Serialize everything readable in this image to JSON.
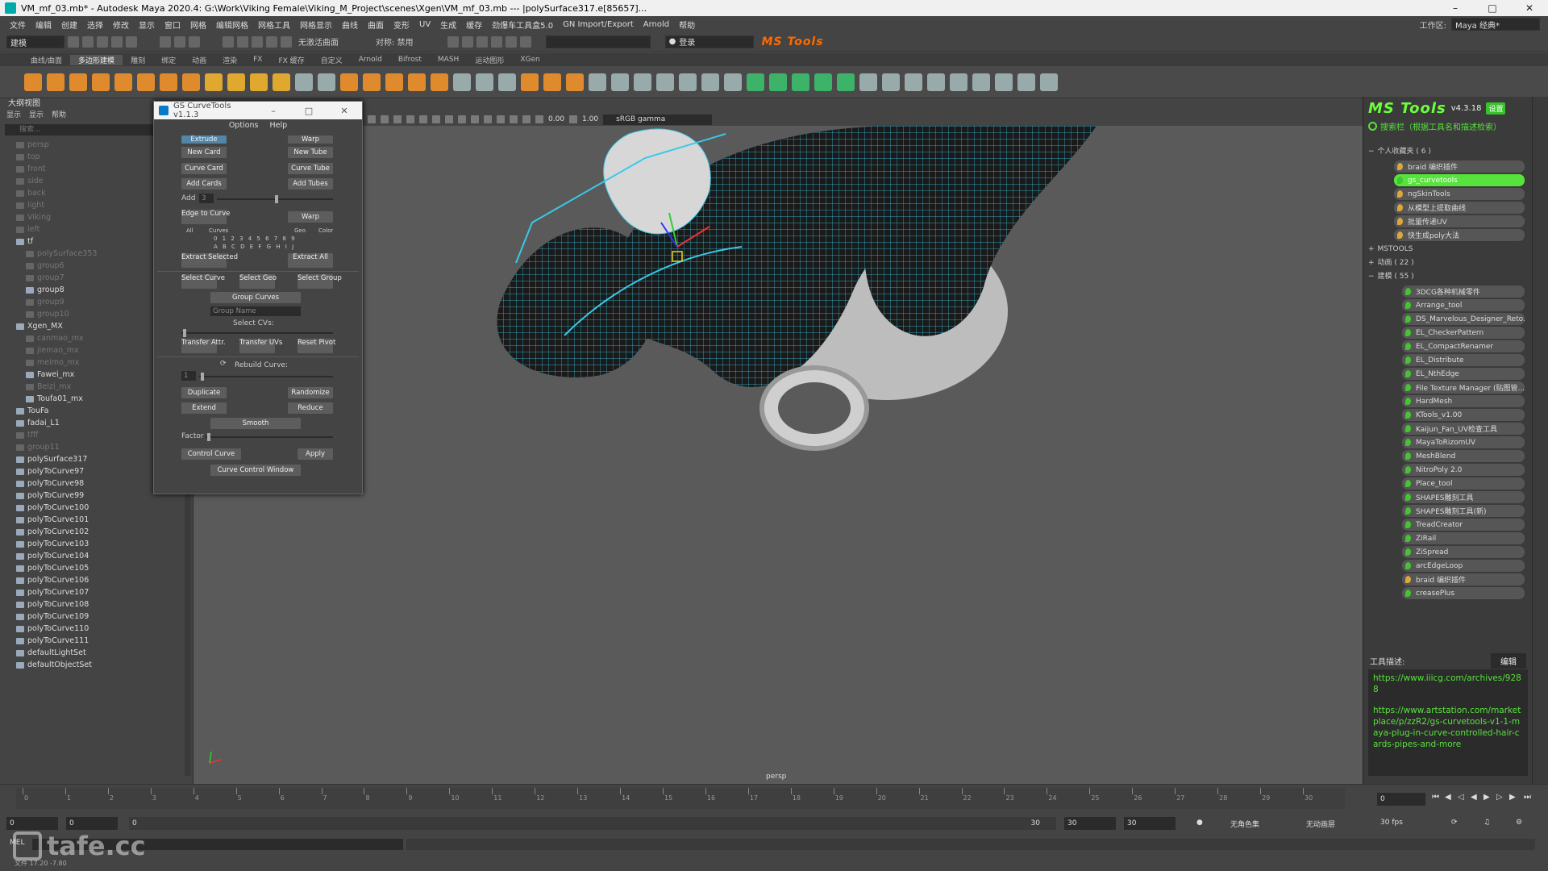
{
  "window": {
    "title": "VM_mf_03.mb* - Autodesk Maya 2020.4: G:\\Work\\Viking Female\\Viking_M_Project\\scenes\\Xgen\\VM_mf_03.mb   ---   |polySurface317.e[85657]..."
  },
  "menubar": {
    "items": [
      "文件",
      "编辑",
      "创建",
      "选择",
      "修改",
      "显示",
      "窗口",
      "网格",
      "编辑网格",
      "网格工具",
      "网格显示",
      "曲线",
      "曲面",
      "变形",
      "UV",
      "生成",
      "缓存",
      "劲爆车工具盒5.0",
      "GN Import/Export",
      "Arnold",
      "帮助"
    ],
    "workspace_label": "工作区:",
    "workspace_value": "Maya 经典*"
  },
  "statusline": {
    "mode": "建模",
    "symmetry": "无激活曲面",
    "symmetry2": "对称: 禁用",
    "login": "登录",
    "logo": "MS Tools"
  },
  "shelf": {
    "tabs": [
      "曲线/曲面",
      "多边形建模",
      "雕刻",
      "绑定",
      "动画",
      "渲染",
      "FX",
      "FX 缓存",
      "自定义",
      "Arnold",
      "Bifrost",
      "MASH",
      "运动图形",
      "XGen"
    ],
    "active_tab": 1
  },
  "outliner": {
    "title": "大纲视图",
    "menu": [
      "显示",
      "显示",
      "帮助"
    ],
    "search_placeholder": "搜索...",
    "rows": [
      {
        "label": "persp",
        "dim": true,
        "indent": 1
      },
      {
        "label": "top",
        "dim": true,
        "indent": 1
      },
      {
        "label": "front",
        "dim": true,
        "indent": 1
      },
      {
        "label": "side",
        "dim": true,
        "indent": 1
      },
      {
        "label": "back",
        "dim": true,
        "indent": 1
      },
      {
        "label": "light",
        "dim": true,
        "indent": 1
      },
      {
        "label": "Viking",
        "dim": true,
        "indent": 1
      },
      {
        "label": "left",
        "dim": true,
        "indent": 1
      },
      {
        "label": "tf",
        "dim": false,
        "indent": 1
      },
      {
        "label": "polySurface353",
        "dim": true,
        "indent": 2
      },
      {
        "label": "group6",
        "dim": true,
        "indent": 2
      },
      {
        "label": "group7",
        "dim": true,
        "indent": 2
      },
      {
        "label": "group8",
        "dim": false,
        "indent": 2
      },
      {
        "label": "group9",
        "dim": true,
        "indent": 2
      },
      {
        "label": "group10",
        "dim": true,
        "indent": 2
      },
      {
        "label": "Xgen_MX",
        "dim": false,
        "indent": 1
      },
      {
        "label": "canmao_mx",
        "dim": true,
        "indent": 2
      },
      {
        "label": "jiemao_mx",
        "dim": true,
        "indent": 2
      },
      {
        "label": "meimo_mx",
        "dim": true,
        "indent": 2
      },
      {
        "label": "Fawei_mx",
        "dim": false,
        "indent": 2
      },
      {
        "label": "Beizi_mx",
        "dim": true,
        "indent": 2
      },
      {
        "label": "Toufa01_mx",
        "dim": false,
        "indent": 2
      },
      {
        "label": "TouFa",
        "dim": false,
        "indent": 1
      },
      {
        "label": "fadai_L1",
        "dim": false,
        "indent": 1
      },
      {
        "label": "tfff",
        "dim": true,
        "indent": 1
      },
      {
        "label": "group11",
        "dim": true,
        "indent": 1
      },
      {
        "label": "polySurface317",
        "dim": false,
        "indent": 1
      },
      {
        "label": "polyToCurve97",
        "dim": false,
        "indent": 1
      },
      {
        "label": "polyToCurve98",
        "dim": false,
        "indent": 1
      },
      {
        "label": "polyToCurve99",
        "dim": false,
        "indent": 1
      },
      {
        "label": "polyToCurve100",
        "dim": false,
        "indent": 1
      },
      {
        "label": "polyToCurve101",
        "dim": false,
        "indent": 1
      },
      {
        "label": "polyToCurve102",
        "dim": false,
        "indent": 1
      },
      {
        "label": "polyToCurve103",
        "dim": false,
        "indent": 1
      },
      {
        "label": "polyToCurve104",
        "dim": false,
        "indent": 1
      },
      {
        "label": "polyToCurve105",
        "dim": false,
        "indent": 1
      },
      {
        "label": "polyToCurve106",
        "dim": false,
        "indent": 1
      },
      {
        "label": "polyToCurve107",
        "dim": false,
        "indent": 1
      },
      {
        "label": "polyToCurve108",
        "dim": false,
        "indent": 1
      },
      {
        "label": "polyToCurve109",
        "dim": false,
        "indent": 1
      },
      {
        "label": "polyToCurve110",
        "dim": false,
        "indent": 1
      },
      {
        "label": "polyToCurve111",
        "dim": false,
        "indent": 1
      },
      {
        "label": "defaultLightSet",
        "dim": false,
        "indent": 1
      },
      {
        "label": "defaultObjectSet",
        "dim": false,
        "indent": 1
      }
    ]
  },
  "gs": {
    "title": "GS CurveTools v1.1.3",
    "menu": [
      "Options",
      "Help"
    ],
    "extrude": "Extrude",
    "warp_toggle": "Warp",
    "new_card": "New Card",
    "new_tube": "New Tube",
    "curve_card": "Curve Card",
    "curve_tube": "Curve Tube",
    "add_cards": "Add Cards",
    "add_tubes": "Add Tubes",
    "add_label": "Add",
    "add_value": "3",
    "edge_to_curve": "Edge to Curve",
    "warp": "Warp",
    "all": "All",
    "curves": "Curves",
    "geo": "Geo",
    "color": "Color",
    "layers_top": "0 1 2 3 4 5 6 7 8 9",
    "layers_bottom": "A B C D E F G H I J",
    "extract_selected": "Extract Selected",
    "extract_all": "Extract All",
    "select_curve": "Select Curve",
    "select_geo": "Select Geo",
    "select_group": "Select Group",
    "group_curves": "Group Curves",
    "group_name": "Group Name",
    "select_cvs": "Select CVs:",
    "transfer_attr": "Transfer Attr.",
    "transfer_uvs": "Transfer UVs",
    "reset_pivot": "Reset Pivot",
    "rebuild_curve": "Rebuild Curve:",
    "rebuild_value": "1",
    "duplicate": "Duplicate",
    "randomize": "Randomize",
    "extend": "Extend",
    "reduce": "Reduce",
    "smooth": "Smooth",
    "factor": "Factor",
    "control_curve": "Control Curve",
    "apply": "Apply",
    "curve_control_window": "Curve Control Window"
  },
  "viewport": {
    "value1": "0.00",
    "value2": "1.00",
    "color_space": "sRGB gamma",
    "camera": "persp"
  },
  "mstools": {
    "logo": "MS Tools",
    "version": "v4.3.18",
    "settings": "设置",
    "search": "搜索栏（根据工具名和描述检索）",
    "sections": [
      {
        "label": "个人收藏夹 ( 6 )",
        "items": [
          {
            "label": "braid 编织插件",
            "sel": false,
            "gold": true
          },
          {
            "label": "gs_curvetools",
            "sel": true,
            "gold": false
          },
          {
            "label": "ngSkinTools",
            "sel": false,
            "gold": true
          },
          {
            "label": "从模型上提取曲线",
            "sel": false,
            "gold": true
          },
          {
            "label": "批量传递UV",
            "sel": false,
            "gold": true
          },
          {
            "label": "快生成poly大法",
            "sel": false,
            "gold": true
          }
        ]
      },
      {
        "label": "MSTOOLS",
        "items": []
      },
      {
        "label": "动画 ( 22 )",
        "items": []
      },
      {
        "label": "建模 ( 55 )",
        "items": [
          {
            "label": "3DCG各种机械零件",
            "sel": false,
            "gold": false
          },
          {
            "label": "Arrange_tool",
            "sel": false,
            "gold": false
          },
          {
            "label": "DS_Marvelous_Designer_Reto...",
            "sel": false,
            "gold": false
          },
          {
            "label": "EL_CheckerPattern",
            "sel": false,
            "gold": false
          },
          {
            "label": "EL_CompactRenamer",
            "sel": false,
            "gold": false
          },
          {
            "label": "EL_Distribute",
            "sel": false,
            "gold": false
          },
          {
            "label": "EL_NthEdge",
            "sel": false,
            "gold": false
          },
          {
            "label": "File Texture Manager (贴图管...",
            "sel": false,
            "gold": false
          },
          {
            "label": "HardMesh",
            "sel": false,
            "gold": false
          },
          {
            "label": "KTools_v1.00",
            "sel": false,
            "gold": false
          },
          {
            "label": "Kaijun_Fan_UV检查工具",
            "sel": false,
            "gold": false
          },
          {
            "label": "MayaToRizomUV",
            "sel": false,
            "gold": false
          },
          {
            "label": "MeshBlend",
            "sel": false,
            "gold": false
          },
          {
            "label": "NitroPoly 2.0",
            "sel": false,
            "gold": false
          },
          {
            "label": "Place_tool",
            "sel": false,
            "gold": false
          },
          {
            "label": "SHAPES雕刻工具",
            "sel": false,
            "gold": false
          },
          {
            "label": "SHAPES雕刻工具(新)",
            "sel": false,
            "gold": false
          },
          {
            "label": "TreadCreator",
            "sel": false,
            "gold": false
          },
          {
            "label": "ZiRail",
            "sel": false,
            "gold": false
          },
          {
            "label": "ZiSpread",
            "sel": false,
            "gold": false
          },
          {
            "label": "arcEdgeLoop",
            "sel": false,
            "gold": false
          },
          {
            "label": "braid 编织插件",
            "sel": false,
            "gold": true
          },
          {
            "label": "creasePlus",
            "sel": false,
            "gold": false
          }
        ]
      }
    ],
    "desc_label": "工具描述:",
    "edit": "编辑",
    "desc_url1": "https://www.iiicg.com/archives/9288",
    "desc_url2": "https://www.artstation.com/marketplace/p/zzR2/gs-curvetools-v1-1-maya-plug-in-curve-controlled-hair-cards-pipes-and-more"
  },
  "timeline": {
    "ticks": [
      "0",
      "1",
      "2",
      "3",
      "4",
      "5",
      "6",
      "7",
      "8",
      "9",
      "10",
      "11",
      "12",
      "13",
      "14",
      "15",
      "16",
      "17",
      "18",
      "19",
      "20",
      "21",
      "22",
      "23",
      "24",
      "25",
      "26",
      "27",
      "28",
      "29",
      "30"
    ],
    "current_frame": "0"
  },
  "range": {
    "start": "0",
    "inner_start": "0",
    "slider_start": "0",
    "slider_end": "30",
    "inner_end": "30",
    "end": "30",
    "char_set": "无角色集",
    "anim_layer": "无动画层",
    "fps": "30 fps"
  },
  "cmd": {
    "lang": "MEL"
  },
  "help": {
    "text": "文件 17.20   -7.80"
  },
  "watermark": {
    "text": "tafe.cc"
  }
}
